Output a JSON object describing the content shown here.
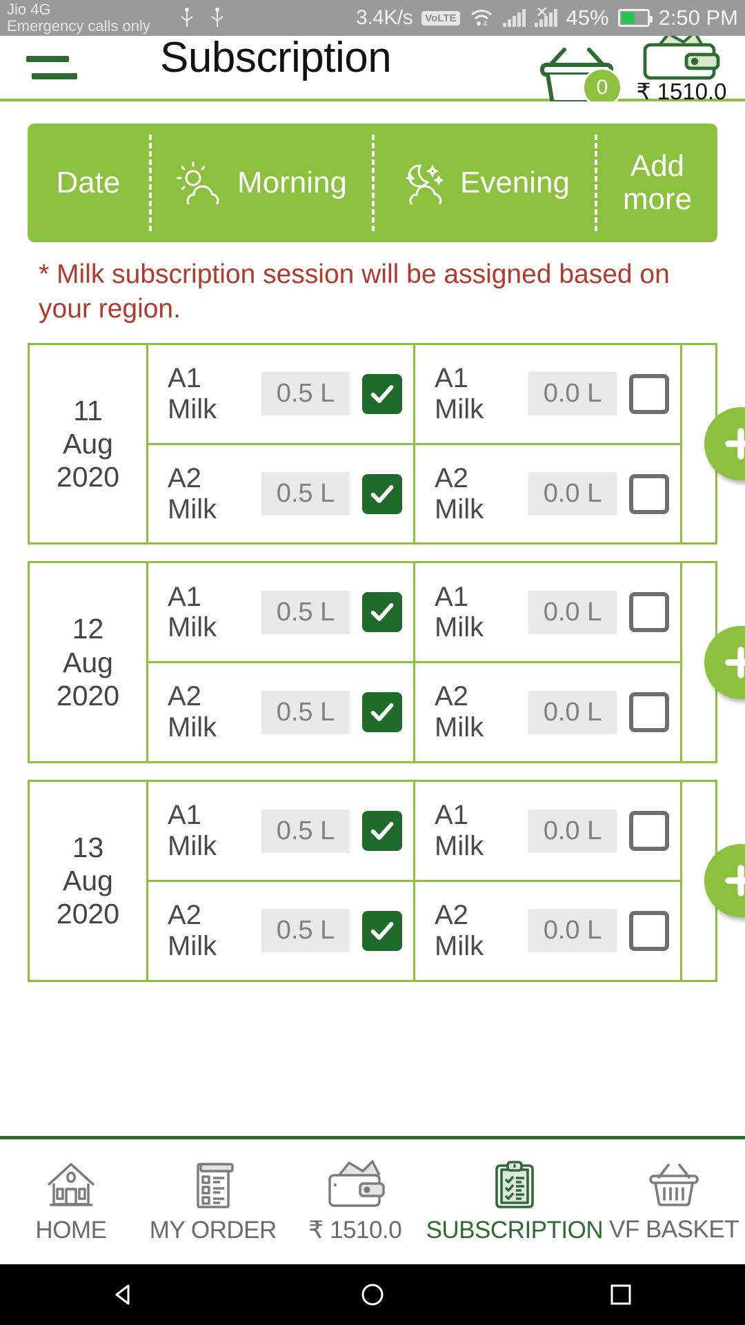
{
  "statusbar": {
    "carrier": "Jio 4G",
    "emergency": "Emergency calls only",
    "speed": "3.4K/s",
    "volte": "VoLTE",
    "battery_pct": "45%",
    "time": "2:50 PM"
  },
  "header": {
    "title": "Subscription",
    "menu_icon": "hamburger-icon",
    "basket_icon": "basket-icon",
    "basket_count": "0",
    "wallet_icon": "wallet-icon",
    "wallet_amount": "₹ 1510.0"
  },
  "table_header": {
    "date": "Date",
    "morning": "Morning",
    "morning_icon": "sun-cloud-icon",
    "evening": "Evening",
    "evening_icon": "moon-cloud-icon",
    "add_more": "Add more"
  },
  "note": "* Milk subscription session will be assigned based on your region.",
  "colors": {
    "accent_green": "#8cc03f",
    "dark_green": "#2e6b33",
    "checked_green": "#1f6b2b",
    "note_red": "#b33a2b",
    "qty_bg": "#e9e9e9",
    "statusbar_bg": "#9a9a9a"
  },
  "days": [
    {
      "day": "11",
      "month": "Aug",
      "year": "2020",
      "morning": [
        {
          "product": "A1 Milk",
          "qty": "0.5 L",
          "checked": true
        },
        {
          "product": "A2 Milk",
          "qty": "0.5 L",
          "checked": true
        }
      ],
      "evening": [
        {
          "product": "A1 Milk",
          "qty": "0.0 L",
          "checked": false
        },
        {
          "product": "A2 Milk",
          "qty": "0.0 L",
          "checked": false
        }
      ],
      "add_label": "+"
    },
    {
      "day": "12",
      "month": "Aug",
      "year": "2020",
      "morning": [
        {
          "product": "A1 Milk",
          "qty": "0.5 L",
          "checked": true
        },
        {
          "product": "A2 Milk",
          "qty": "0.5 L",
          "checked": true
        }
      ],
      "evening": [
        {
          "product": "A1 Milk",
          "qty": "0.0 L",
          "checked": false
        },
        {
          "product": "A2 Milk",
          "qty": "0.0 L",
          "checked": false
        }
      ],
      "add_label": "+"
    },
    {
      "day": "13",
      "month": "Aug",
      "year": "2020",
      "morning": [
        {
          "product": "A1 Milk",
          "qty": "0.5 L",
          "checked": true
        },
        {
          "product": "A2 Milk",
          "qty": "0.5 L",
          "checked": true
        }
      ],
      "evening": [
        {
          "product": "A1 Milk",
          "qty": "0.0 L",
          "checked": false
        },
        {
          "product": "A2 Milk",
          "qty": "0.0 L",
          "checked": false
        }
      ],
      "add_label": "+"
    }
  ],
  "bottom_nav": [
    {
      "label": "HOME",
      "icon": "home-icon",
      "active": false
    },
    {
      "label": "MY ORDER",
      "icon": "order-list-icon",
      "active": false
    },
    {
      "label": "₹ 1510.0",
      "icon": "wallet-icon",
      "active": false
    },
    {
      "label": "SUBSCRIPTION",
      "icon": "clipboard-check-icon",
      "active": true
    },
    {
      "label": "VF BASKET",
      "icon": "basket-icon",
      "active": false
    }
  ],
  "android_nav": {
    "back": "back-triangle-icon",
    "home": "home-circle-icon",
    "recents": "recents-square-icon"
  }
}
